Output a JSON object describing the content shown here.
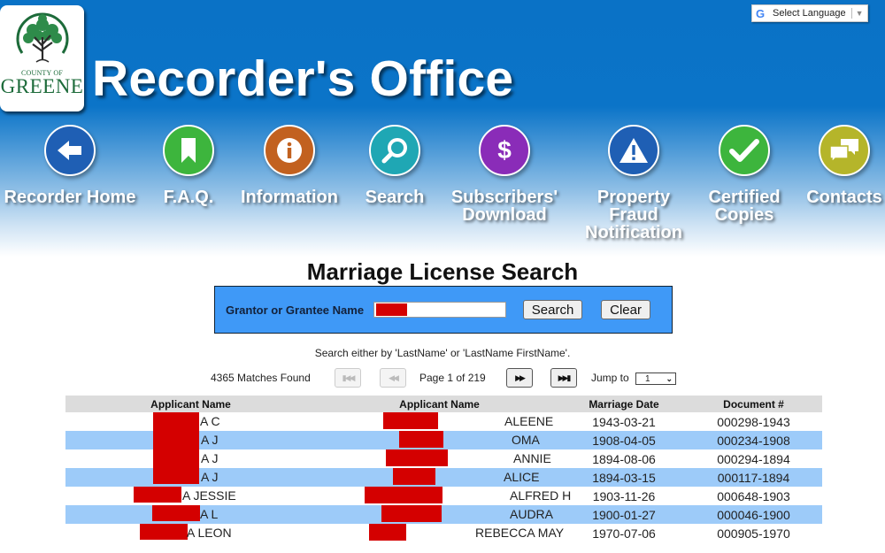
{
  "site": {
    "title": "Recorder's Office",
    "logo": {
      "top_text": "COUNTY OF",
      "bottom_text": "GREENE"
    }
  },
  "language": {
    "label": "Select Language",
    "icon": "google-g-icon"
  },
  "nav": [
    {
      "label": "Recorder Home",
      "icon": "arrow-left-icon",
      "color": "#1f5fb4"
    },
    {
      "label": "F.A.Q.",
      "icon": "bookmark-icon",
      "color": "#3db53d"
    },
    {
      "label": "Information",
      "icon": "info-icon",
      "color": "#c2611f"
    },
    {
      "label": "Search",
      "icon": "magnifier-icon",
      "color": "#1fa7b4"
    },
    {
      "label": "Subscribers'\nDownload",
      "icon": "dollar-icon",
      "color": "#8a2cb8"
    },
    {
      "label": "Property\nFraud\nNotification",
      "icon": "warning-icon",
      "color": "#1f5fb4"
    },
    {
      "label": "Certified\nCopies",
      "icon": "checkmark-icon",
      "color": "#3db53d"
    },
    {
      "label": "Contacts",
      "icon": "chat-bubbles-icon",
      "color": "#b5b52a"
    }
  ],
  "search": {
    "page_title": "Marriage License Search",
    "field_label": "Grantor or Grantee Name",
    "field_value": "[redacted]",
    "search_label": "Search",
    "clear_label": "Clear",
    "hint": "Search either by 'LastName' or 'LastName FirstName'."
  },
  "pager": {
    "matches": "4365 Matches Found",
    "page_info": "Page 1 of 219",
    "current_page": 1,
    "total_pages": 219,
    "jump_label": "Jump to",
    "jump_value": "1",
    "first_icon": "first-page-icon",
    "prev_icon": "prev-page-icon",
    "next_icon": "next-page-icon",
    "last_icon": "last-page-icon"
  },
  "table": {
    "headers": [
      "Applicant Name",
      "Applicant Name",
      "Marriage Date",
      "Document #"
    ],
    "rows": [
      {
        "applicant1": "A C",
        "applicant2": "ALEENE",
        "date": "1943-03-21",
        "doc": "000298-1943"
      },
      {
        "applicant1": "A J",
        "applicant2": "OMA",
        "date": "1908-04-05",
        "doc": "000234-1908"
      },
      {
        "applicant1": "A J",
        "applicant2": "ANNIE",
        "date": "1894-08-06",
        "doc": "000294-1894"
      },
      {
        "applicant1": "A J",
        "applicant2": "ALICE",
        "date": "1894-03-15",
        "doc": "000117-1894"
      },
      {
        "applicant1": "A JESSIE",
        "applicant2": "ALFRED H",
        "date": "1903-11-26",
        "doc": "000648-1903"
      },
      {
        "applicant1": "A L",
        "applicant2": "AUDRA",
        "date": "1900-01-27",
        "doc": "000046-1900"
      },
      {
        "applicant1": "A LEON",
        "applicant2": "REBECCA MAY",
        "date": "1970-07-06",
        "doc": "000905-1970"
      }
    ]
  },
  "colors": {
    "header_blue": "#0b74c8",
    "search_box": "#3f99f7",
    "row_alt": "#9dcbf9",
    "redaction": "#d40000"
  }
}
